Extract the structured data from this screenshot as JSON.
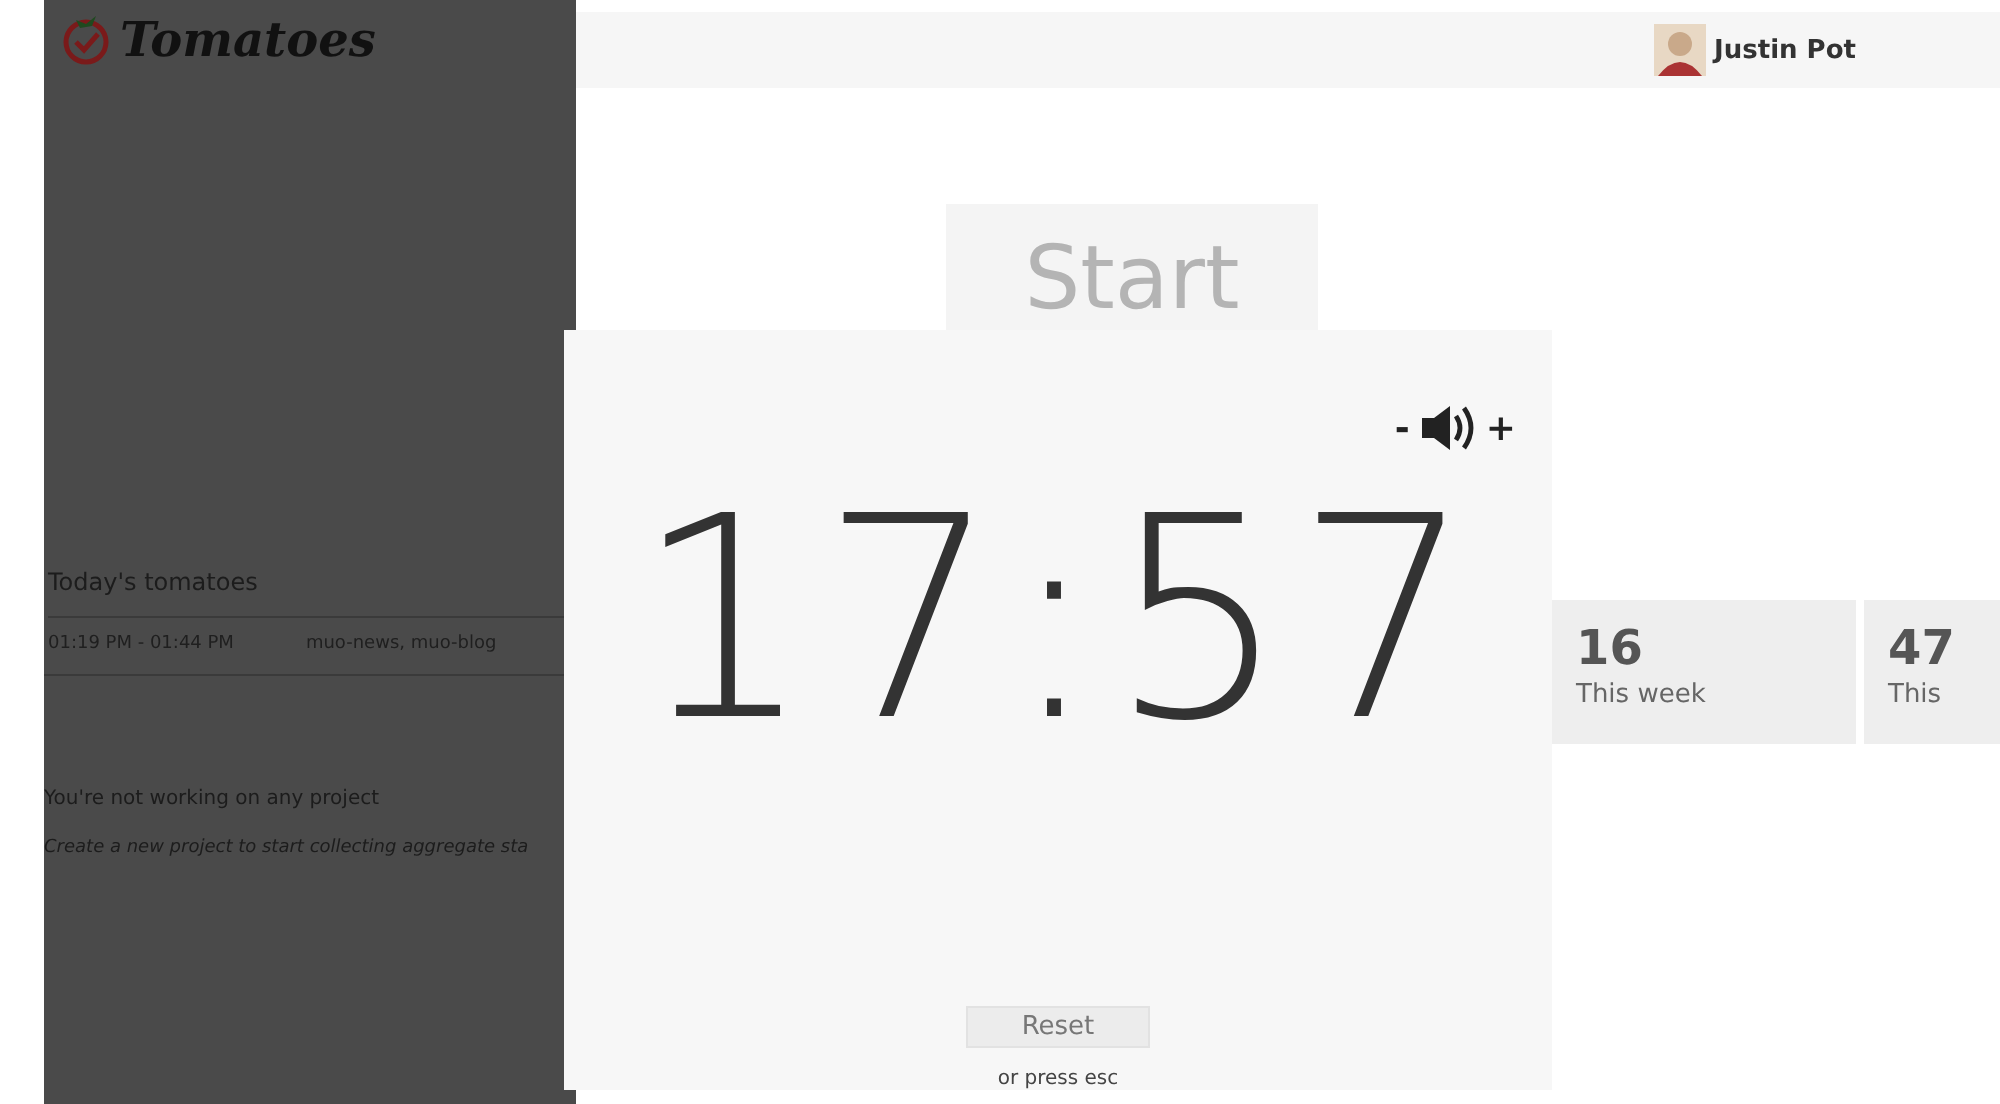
{
  "app": {
    "logo": "Tomatoes"
  },
  "user": {
    "name": "Justin Pot"
  },
  "sidebar": {
    "section_title": "Today's tomatoes",
    "entries": [
      {
        "time": "01:19 PM - 01:44 PM",
        "tags": "muo-news, muo-blog"
      }
    ],
    "project_status": "You're not working on any project",
    "project_hint": "Create a new project to start collecting aggregate sta"
  },
  "start_button": "Start",
  "stats": [
    {
      "value": "16",
      "label": "This week"
    },
    {
      "value": "47",
      "label": "This"
    }
  ],
  "timer": {
    "volume_down": "-",
    "volume_up": "+",
    "time": "17:57",
    "reset": "Reset",
    "hint": "or press esc"
  }
}
